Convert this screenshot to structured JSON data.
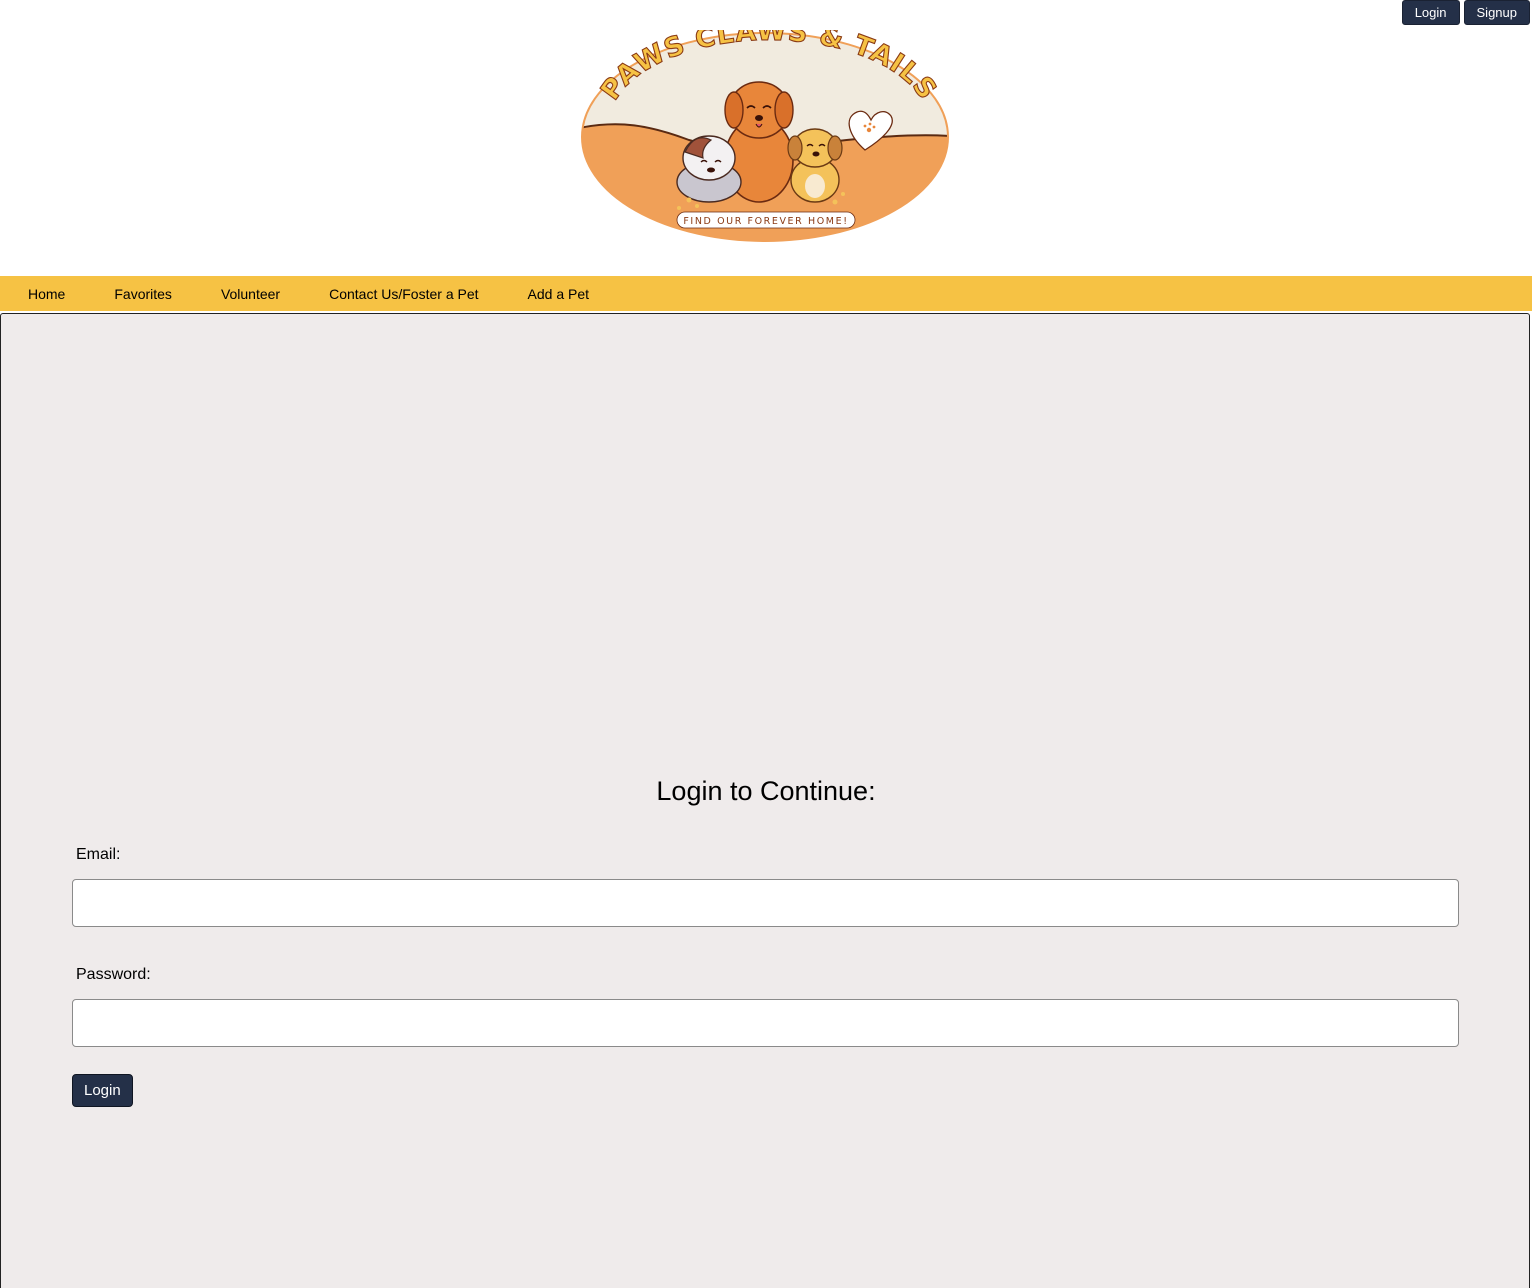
{
  "header": {
    "auth": {
      "login_label": "Login",
      "signup_label": "Signup"
    },
    "logo": {
      "title_text": "PAWS CLAWS & TAILS",
      "banner_text": "FIND OUR FOREVER HOME!"
    }
  },
  "nav": {
    "items": [
      {
        "label": "Home"
      },
      {
        "label": "Favorites"
      },
      {
        "label": "Volunteer"
      },
      {
        "label": "Contact Us/Foster a Pet"
      },
      {
        "label": "Add a Pet"
      }
    ]
  },
  "login_form": {
    "title": "Login to Continue:",
    "email_label": "Email:",
    "email_value": "",
    "password_label": "Password:",
    "password_value": "",
    "submit_label": "Login"
  },
  "colors": {
    "nav_bg": "#f6c244",
    "button_bg": "#243048",
    "panel_bg": "#efebeb",
    "logo_orange": "#f0a058",
    "logo_cream": "#f1ebdf"
  }
}
